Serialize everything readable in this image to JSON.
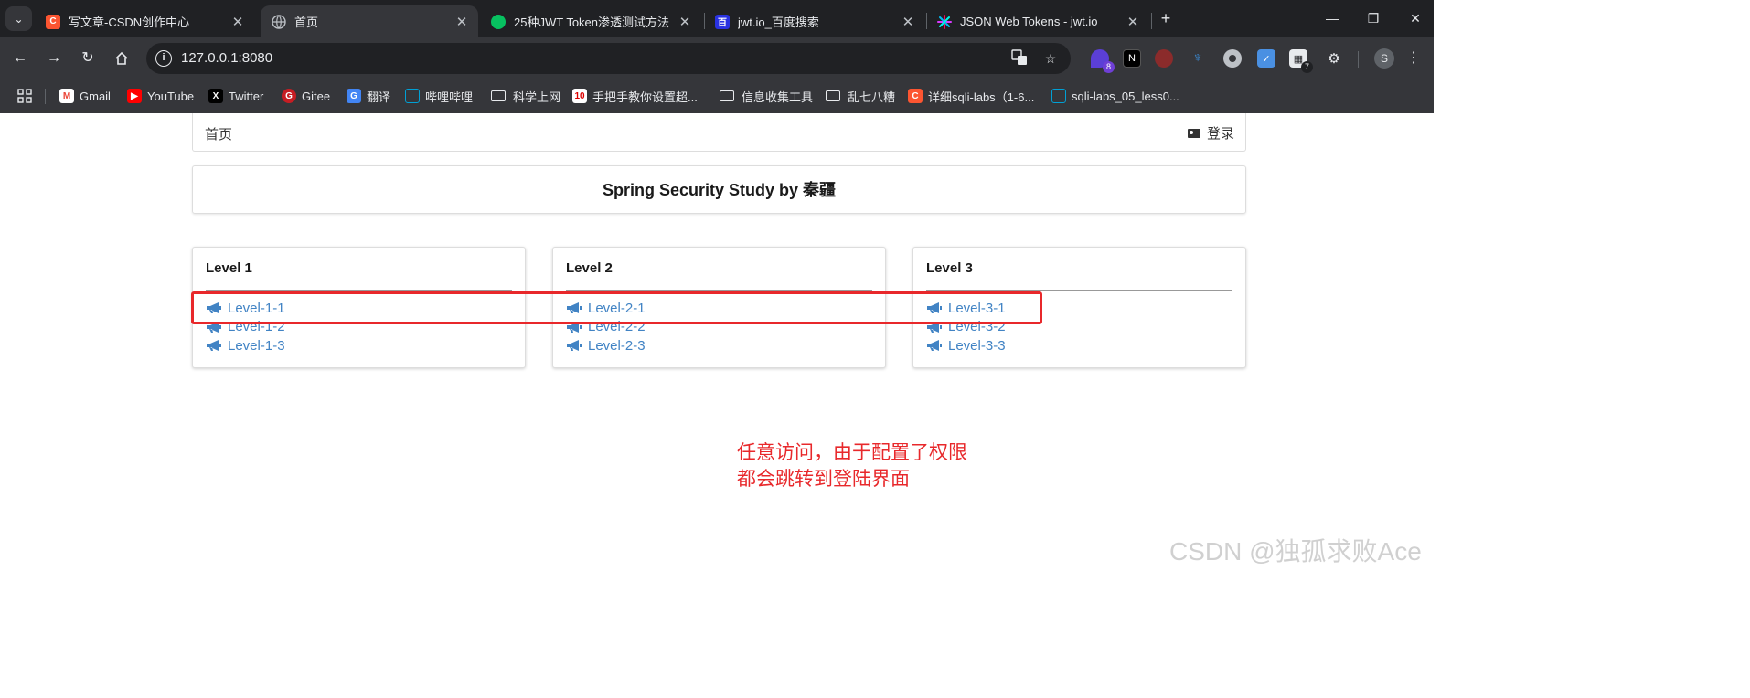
{
  "browser": {
    "tabs": [
      {
        "title": "写文章-CSDN创作中心",
        "icon": "csdn-icon",
        "active": false
      },
      {
        "title": "首页",
        "icon": "globe-icon",
        "active": true
      },
      {
        "title": "25种JWT Token渗透测试方法",
        "icon": "wechat-icon",
        "active": false
      },
      {
        "title": "jwt.io_百度搜索",
        "icon": "baidu-icon",
        "active": false
      },
      {
        "title": "JSON Web Tokens - jwt.io",
        "icon": "jwt-icon",
        "active": false
      }
    ],
    "url": "127.0.0.1:8080",
    "extension_badges": {
      "first": "8",
      "second": "7"
    },
    "profile_initial": "S",
    "bookmarks": [
      {
        "label": "Gmail",
        "icon": "gmail-icon"
      },
      {
        "label": "YouTube",
        "icon": "youtube-icon"
      },
      {
        "label": "Twitter",
        "icon": "x-icon"
      },
      {
        "label": "Gitee",
        "icon": "gitee-icon"
      },
      {
        "label": "翻译",
        "icon": "translate-icon"
      },
      {
        "label": "哔哩哔哩",
        "icon": "bilibili-icon"
      },
      {
        "label": "科学上网",
        "icon": "folder-icon"
      },
      {
        "label": "手把手教你设置超...",
        "icon": "bookmark-10-icon"
      },
      {
        "label": "信息收集工具",
        "icon": "folder-icon"
      },
      {
        "label": "乱七八糟",
        "icon": "folder-icon"
      },
      {
        "label": "详细sqli-labs（1-6...",
        "icon": "csdn-icon"
      },
      {
        "label": "sqli-labs_05_less0...",
        "icon": "bilibili-icon"
      }
    ]
  },
  "page": {
    "nav": {
      "home": "首页",
      "login": "登录"
    },
    "title": "Spring Security Study by 秦疆",
    "levels": [
      {
        "title": "Level 1",
        "links": [
          "Level-1-1",
          "Level-1-2",
          "Level-1-3"
        ]
      },
      {
        "title": "Level 2",
        "links": [
          "Level-2-1",
          "Level-2-2",
          "Level-2-3"
        ]
      },
      {
        "title": "Level 3",
        "links": [
          "Level-3-1",
          "Level-3-2",
          "Level-3-3"
        ]
      }
    ],
    "link_color": "#4183c4"
  },
  "annotation": {
    "line1": "任意访问，由于配置了权限",
    "line2": "都会跳转到登陆界面",
    "color": "#e8282b"
  },
  "watermark": "CSDN @独孤求败Ace"
}
